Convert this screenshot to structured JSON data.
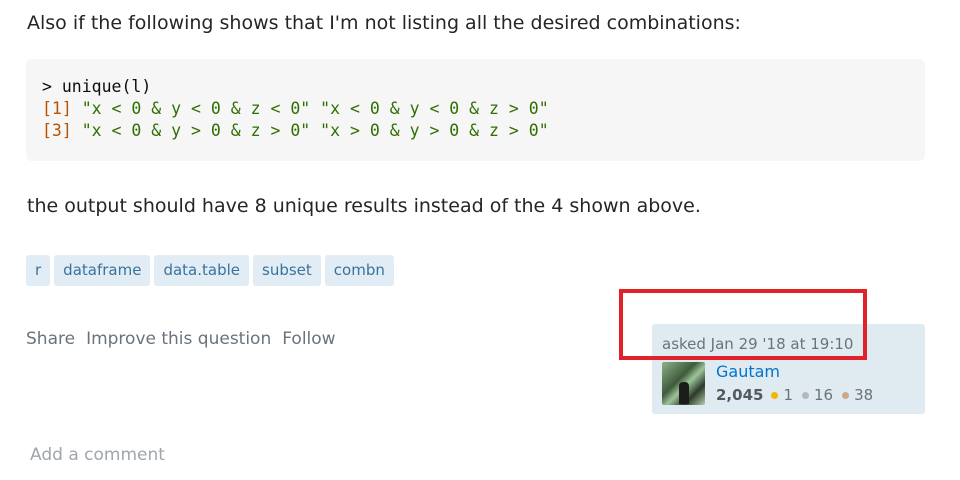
{
  "body": {
    "para1": "Also if the following shows that I'm not listing all the desired combinations:",
    "code_lines": [
      {
        "prompt": "> unique(l)"
      },
      {
        "idx": "[1]",
        "s1": "\"x < 0 & y < 0 & z < 0\"",
        "s2": "\"x < 0 & y < 0 & z > 0\""
      },
      {
        "idx": "[3]",
        "s1": "\"x < 0 & y > 0 & z > 0\"",
        "s2": "\"x > 0 & y > 0 & z > 0\""
      }
    ],
    "para2": "the output should have 8 unique results instead of the 4 shown above."
  },
  "tags": [
    "r",
    "dataframe",
    "data.table",
    "subset",
    "combn"
  ],
  "actions": {
    "share": "Share",
    "improve": "Improve this question",
    "follow": "Follow"
  },
  "user_card": {
    "asked": "asked Jan 29 '18 at 19:10",
    "name": "Gautam",
    "reputation": "2,045",
    "gold": "1",
    "silver": "16",
    "bronze": "38",
    "avatar_icon": "user-avatar-photo"
  },
  "comment": {
    "add": "Add a comment"
  },
  "highlight_color": "#e2222a"
}
